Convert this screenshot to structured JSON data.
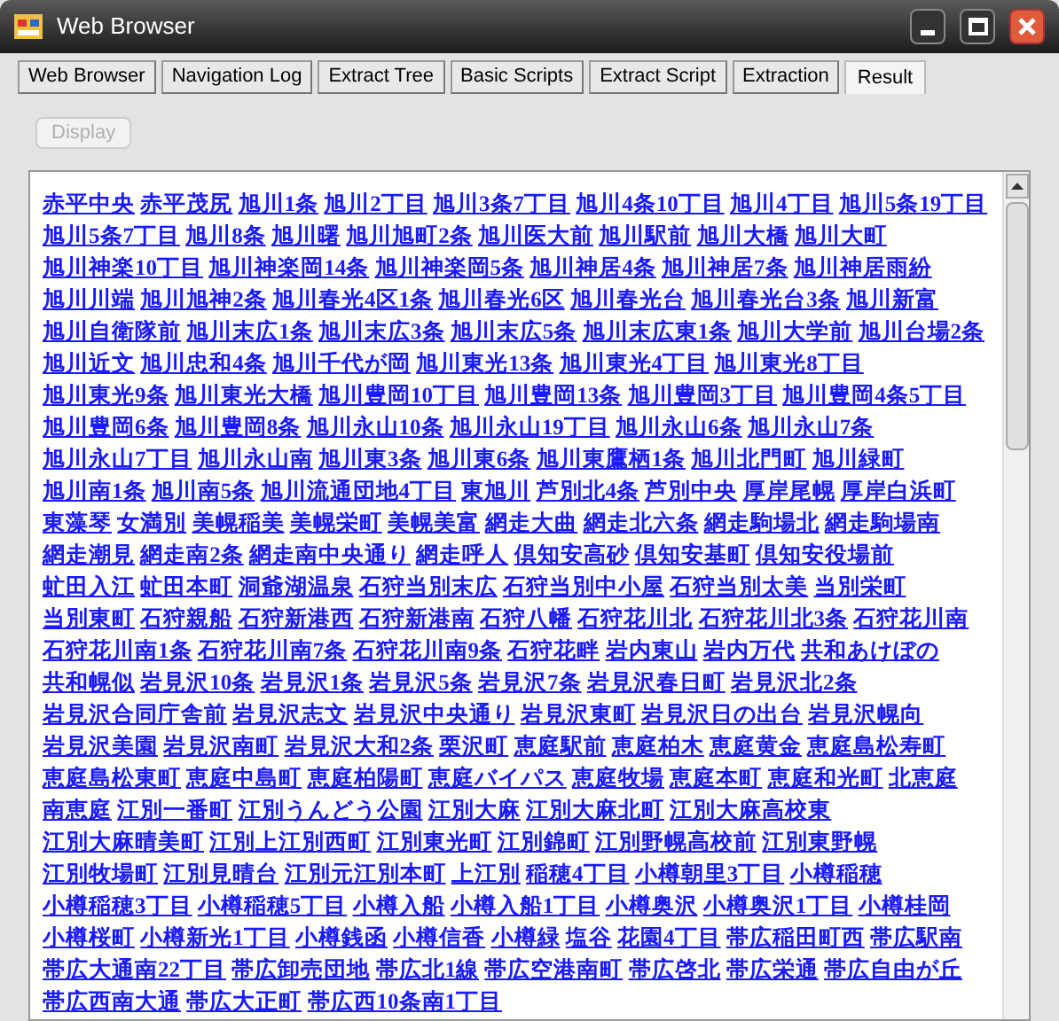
{
  "window": {
    "title": "Web Browser"
  },
  "tabs": [
    {
      "label": "Web Browser",
      "selected": false
    },
    {
      "label": "Navigation Log",
      "selected": false
    },
    {
      "label": "Extract Tree",
      "selected": false
    },
    {
      "label": "Basic Scripts",
      "selected": false
    },
    {
      "label": "Extract Script",
      "selected": false
    },
    {
      "label": "Extraction",
      "selected": false
    },
    {
      "label": "Result",
      "selected": true
    }
  ],
  "display_button": {
    "label": "Display",
    "disabled": true
  },
  "links": [
    "赤平中央",
    "赤平茂尻",
    "旭川1条",
    "旭川2丁目",
    "旭川3条7丁目",
    "旭川4条10丁目",
    "旭川4丁目",
    "旭川5条19丁目",
    "旭川5条7丁目",
    "旭川8条",
    "旭川曙",
    "旭川旭町2条",
    "旭川医大前",
    "旭川駅前",
    "旭川大橋",
    "旭川大町",
    "旭川神楽10丁目",
    "旭川神楽岡14条",
    "旭川神楽岡5条",
    "旭川神居4条",
    "旭川神居7条",
    "旭川神居雨紛",
    "旭川川端",
    "旭川旭神2条",
    "旭川春光4区1条",
    "旭川春光6区",
    "旭川春光台",
    "旭川春光台3条",
    "旭川新富",
    "旭川自衛隊前",
    "旭川末広1条",
    "旭川末広3条",
    "旭川末広5条",
    "旭川末広東1条",
    "旭川大学前",
    "旭川台場2条",
    "旭川近文",
    "旭川忠和4条",
    "旭川千代が岡",
    "旭川東光13条",
    "旭川東光4丁目",
    "旭川東光8丁目",
    "旭川東光9条",
    "旭川東光大橋",
    "旭川豊岡10丁目",
    "旭川豊岡13条",
    "旭川豊岡3丁目",
    "旭川豊岡4条5丁目",
    "旭川豊岡6条",
    "旭川豊岡8条",
    "旭川永山10条",
    "旭川永山19丁目",
    "旭川永山6条",
    "旭川永山7条",
    "旭川永山7丁目",
    "旭川永山南",
    "旭川東3条",
    "旭川東6条",
    "旭川東鷹栖1条",
    "旭川北門町",
    "旭川緑町",
    "旭川南1条",
    "旭川南5条",
    "旭川流通団地4丁目",
    "東旭川",
    "芦別北4条",
    "芦別中央",
    "厚岸尾幌",
    "厚岸白浜町",
    "東藻琴",
    "女満別",
    "美幌稲美",
    "美幌栄町",
    "美幌美富",
    "網走大曲",
    "網走北六条",
    "網走駒場北",
    "網走駒場南",
    "網走潮見",
    "網走南2条",
    "網走南中央通り",
    "網走呼人",
    "倶知安高砂",
    "倶知安基町",
    "倶知安役場前",
    "虻田入江",
    "虻田本町",
    "洞爺湖温泉",
    "石狩当別末広",
    "石狩当別中小屋",
    "石狩当別太美",
    "当別栄町",
    "当別東町",
    "石狩親船",
    "石狩新港西",
    "石狩新港南",
    "石狩八幡",
    "石狩花川北",
    "石狩花川北3条",
    "石狩花川南",
    "石狩花川南1条",
    "石狩花川南7条",
    "石狩花川南9条",
    "石狩花畔",
    "岩内東山",
    "岩内万代",
    "共和あけぼの",
    "共和幌似",
    "岩見沢10条",
    "岩見沢1条",
    "岩見沢5条",
    "岩見沢7条",
    "岩見沢春日町",
    "岩見沢北2条",
    "岩見沢合同庁舎前",
    "岩見沢志文",
    "岩見沢中央通り",
    "岩見沢東町",
    "岩見沢日の出台",
    "岩見沢幌向",
    "岩見沢美園",
    "岩見沢南町",
    "岩見沢大和2条",
    "栗沢町",
    "恵庭駅前",
    "恵庭柏木",
    "恵庭黄金",
    "恵庭島松寿町",
    "恵庭島松東町",
    "恵庭中島町",
    "恵庭柏陽町",
    "恵庭バイパス",
    "恵庭牧場",
    "恵庭本町",
    "恵庭和光町",
    "北恵庭",
    "南恵庭",
    "江別一番町",
    "江別うんどう公園",
    "江別大麻",
    "江別大麻北町",
    "江別大麻高校東",
    "江別大麻晴美町",
    "江別上江別西町",
    "江別東光町",
    "江別錦町",
    "江別野幌高校前",
    "江別東野幌",
    "江別牧場町",
    "江別見晴台",
    "江別元江別本町",
    "上江別",
    "稲穂4丁目",
    "小樽朝里3丁目",
    "小樽稲穂",
    "小樽稲穂3丁目",
    "小樽稲穂5丁目",
    "小樽入船",
    "小樽入船1丁目",
    "小樽奥沢",
    "小樽奥沢1丁目",
    "小樽桂岡",
    "小樽桜町",
    "小樽新光1丁目",
    "小樽銭函",
    "小樽信香",
    "小樽緑",
    "塩谷",
    "花園4丁目",
    "帯広稲田町西",
    "帯広駅南",
    "帯広大通南22丁目",
    "帯広卸売団地",
    "帯広北1線",
    "帯広空港南町",
    "帯広啓北",
    "帯広栄通",
    "帯広自由が丘",
    "帯広西南大通",
    "帯広大正町",
    "帯広西10条南1丁目"
  ]
}
